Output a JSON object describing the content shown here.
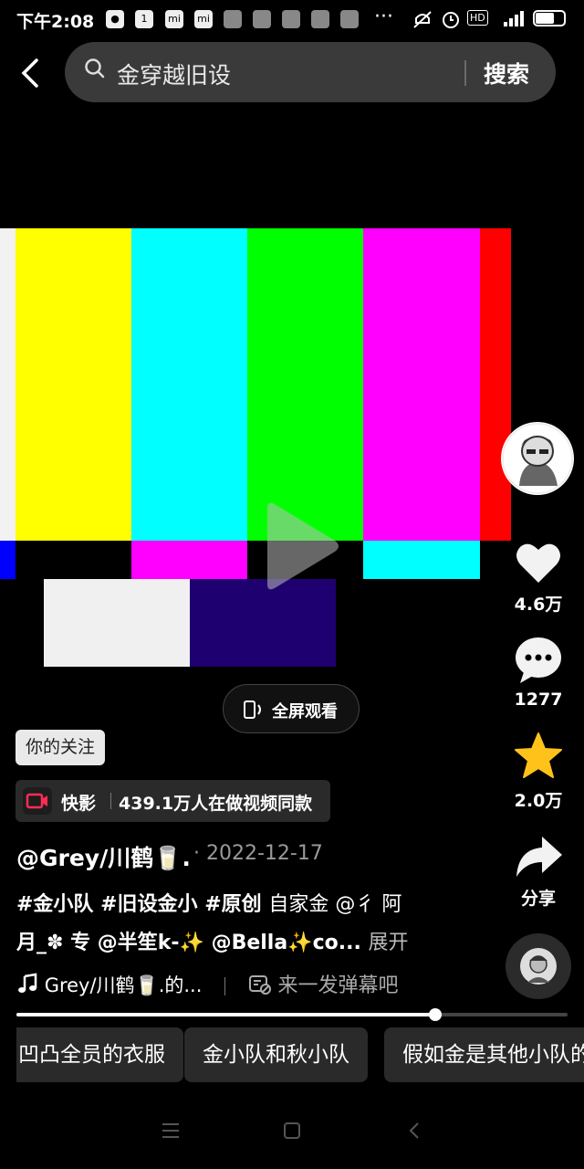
{
  "status": {
    "time": "下午2:08",
    "battery": "66"
  },
  "search": {
    "query": "金穿越旧设",
    "button": "搜索"
  },
  "video": {
    "fullscreen_label": "全屏观看"
  },
  "rail": {
    "likes": "4.6万",
    "comments": "1277",
    "favorites": "2.0万",
    "share": "分享"
  },
  "follow_badge": "你的关注",
  "kuaiying": {
    "name": "快影",
    "stat": "439.1万人在做视频同款"
  },
  "post": {
    "author": "@Grey/川鹤🥛.",
    "date": "· 2022-12-17",
    "line1": {
      "t1": "#金小队",
      "t2": "#旧设金小",
      "t3": "#原创",
      "t4": "自家金 @彳 阿"
    },
    "line2": {
      "t1": "月_✽ 专 @半笙k-✨ @Bella✨co...",
      "more": "展开"
    },
    "music": "Grey/川鹤🥛.的...",
    "danmu": "来一发弹幕吧"
  },
  "progress": {
    "fraction": 0.76
  },
  "chips": [
    "凹凸全员的衣服",
    "金小队和秋小队",
    "假如金是其他小队的"
  ]
}
